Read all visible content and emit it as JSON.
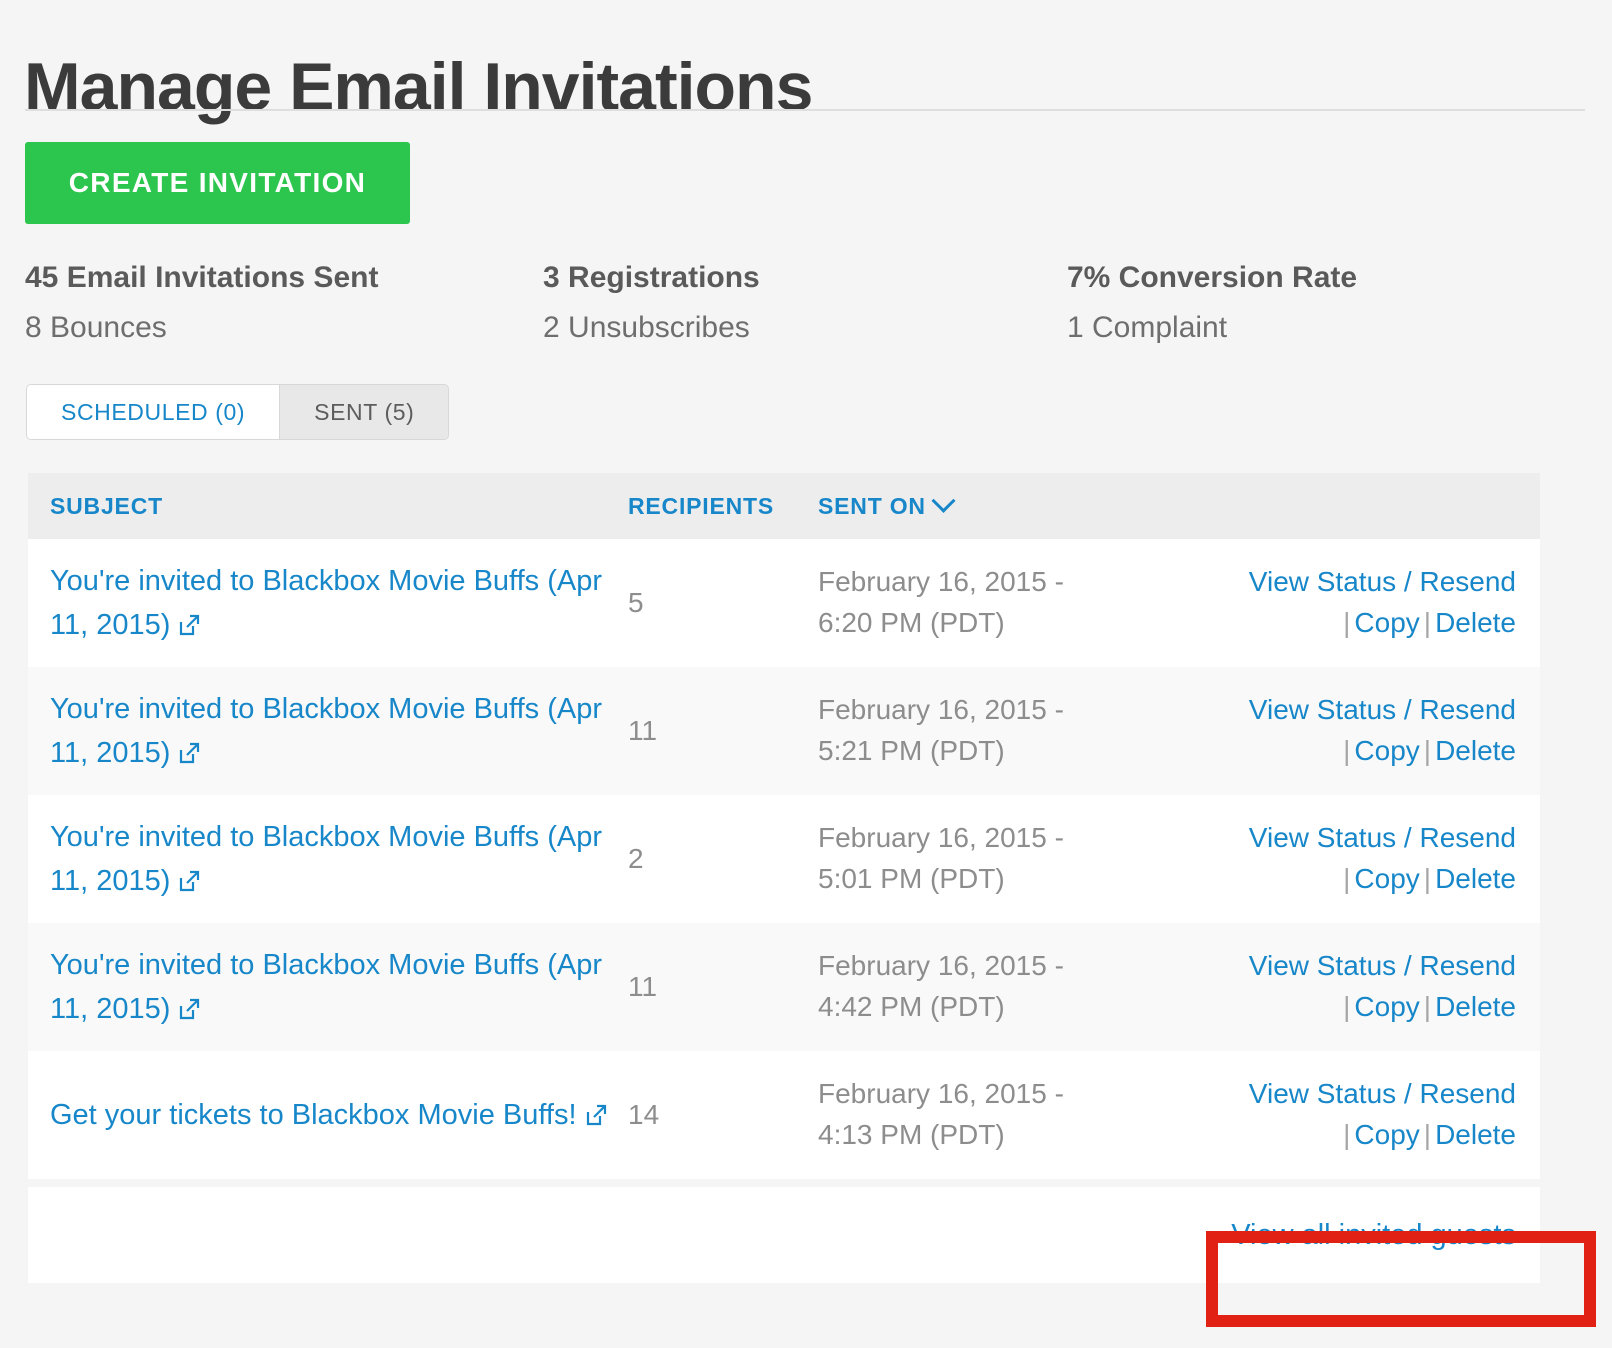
{
  "header": {
    "title": "Manage Email Invitations"
  },
  "toolbar": {
    "create_label": "CREATE INVITATION",
    "create_color": "#2cc64e"
  },
  "stats": [
    {
      "headline": "45 Email Invitations Sent",
      "sub": "8 Bounces"
    },
    {
      "headline": "3 Registrations",
      "sub": "2 Unsubscribes"
    },
    {
      "headline": "7% Conversion Rate",
      "sub": "1 Complaint"
    }
  ],
  "tabs": [
    {
      "label": "SCHEDULED (0)",
      "active": true
    },
    {
      "label": "SENT (5)",
      "active": false
    }
  ],
  "table": {
    "columns": {
      "subject": "SUBJECT",
      "recipients": "RECIPIENTS",
      "sent_on": "SENT ON",
      "sort_icon": "chevron-down-icon"
    },
    "actions": {
      "view_status_resend": "View Status / Resend",
      "copy": "Copy",
      "delete": "Delete",
      "separator": "|"
    },
    "rows": [
      {
        "subject": "You're invited to Blackbox Movie Buffs (Apr 11, 2015)",
        "external_icon": "external-link-icon",
        "recipients": "5",
        "sent_on_date": "February 16, 2015 -",
        "sent_on_time": "6:20 PM (PDT)"
      },
      {
        "subject": "You're invited to Blackbox Movie Buffs (Apr 11, 2015)",
        "external_icon": "external-link-icon",
        "recipients": "11",
        "sent_on_date": "February 16, 2015 -",
        "sent_on_time": "5:21 PM (PDT)"
      },
      {
        "subject": "You're invited to Blackbox Movie Buffs (Apr 11, 2015)",
        "external_icon": "external-link-icon",
        "recipients": "2",
        "sent_on_date": "February 16, 2015 -",
        "sent_on_time": "5:01 PM (PDT)"
      },
      {
        "subject": "You're invited to Blackbox Movie Buffs (Apr 11, 2015)",
        "external_icon": "external-link-icon",
        "recipients": "11",
        "sent_on_date": "February 16, 2015 -",
        "sent_on_time": "4:42 PM (PDT)"
      },
      {
        "subject": "Get your tickets to Blackbox Movie Buffs!",
        "external_icon": "external-link-icon",
        "recipients": "14",
        "sent_on_date": "February 16, 2015 -",
        "sent_on_time": "4:13 PM (PDT)"
      }
    ],
    "footer": {
      "view_all_label": "View all invited guests"
    }
  },
  "annotation": {
    "highlight_color": "#e02113",
    "target": "view-all-invited-guests-link"
  },
  "colors": {
    "link": "#1787c9",
    "accent_green": "#2cc64e",
    "text_dark": "#3b3b3b",
    "text_muted": "#8d8d8d",
    "page_bg": "#f5f5f5"
  }
}
